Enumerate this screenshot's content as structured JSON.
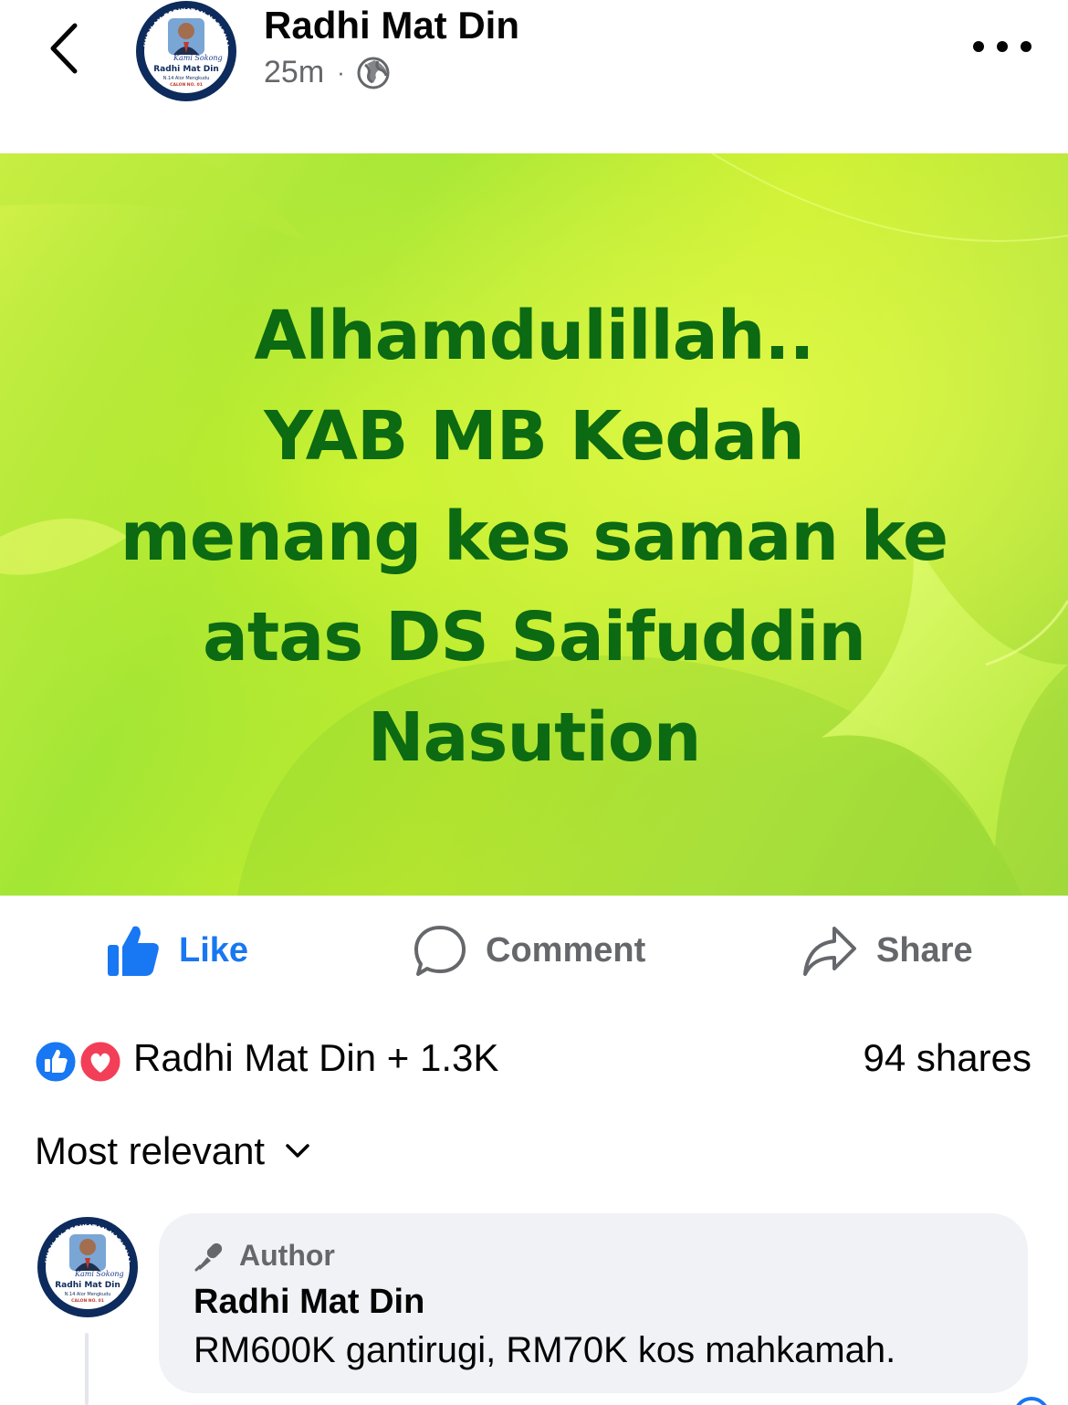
{
  "header": {
    "author_name": "Radhi Mat Din",
    "time": "25m",
    "separator": "·",
    "avatar": {
      "ring_text": "UNDILAH PERIKATAN NASIONAL",
      "script_text": "Kami Sokong",
      "name": "Radhi Mat Din",
      "area": "N.14 Alor Mengkudu",
      "candidate": "CALON NO. 01"
    }
  },
  "post": {
    "lines": [
      "Alhamdulillah..",
      "YAB MB Kedah",
      "menang kes saman ke",
      "atas DS Saifuddin",
      "Nasution"
    ],
    "text_color": "#0b6a12"
  },
  "actions": {
    "like": "Like",
    "comment": "Comment",
    "share": "Share",
    "like_color": "#1877f2"
  },
  "summary": {
    "reactions": "Radhi Mat Din + 1.3K",
    "shares": "94 shares"
  },
  "sort": {
    "label": "Most relevant"
  },
  "comment": {
    "badge": "Author",
    "name": "Radhi Mat Din",
    "text": "RM600K gantirugi, RM70K kos mahkamah."
  },
  "icons": {
    "back": "chevron-left-icon",
    "privacy": "globe-icon",
    "more": "more-horizontal-icon",
    "like": "thumbs-up-icon",
    "comment": "speech-bubble-icon",
    "share": "share-arrow-icon",
    "sort": "chevron-down-icon",
    "badge": "microphone-icon"
  }
}
